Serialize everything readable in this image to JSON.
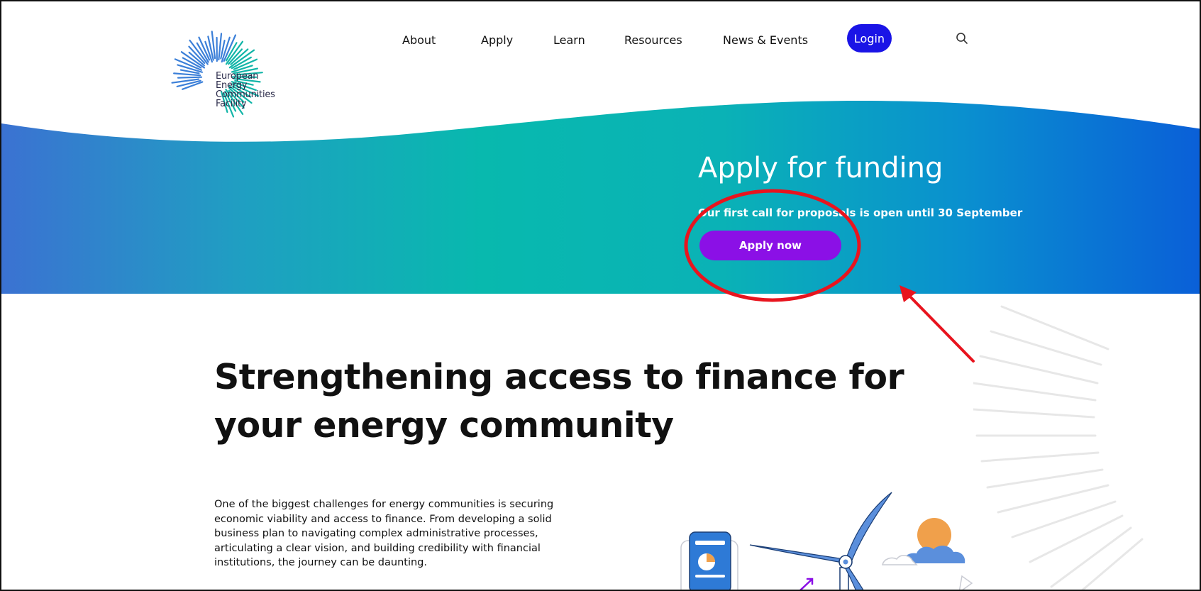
{
  "logo": {
    "icon": "sunburst-logo-icon",
    "lines": [
      "European",
      "Energy",
      "Communities",
      "Facility"
    ]
  },
  "nav": {
    "about": "About",
    "apply": "Apply",
    "learn": "Learn",
    "resources": "Resources",
    "news_events": "News & Events",
    "login": "Login",
    "search_icon": "search-icon"
  },
  "hero": {
    "title": "Apply for funding",
    "subtitle": "Our first call for proposals is open until 30 September",
    "cta": "Apply now"
  },
  "main": {
    "heading": "Strengthening access to finance for your energy community",
    "paragraph": "One of the biggest challenges for energy communities is securing economic viability and access to finance. From developing a solid business plan to navigating complex administrative processes, articulating a clear vision, and building credibility with financial institutions, the journey can be daunting."
  },
  "colors": {
    "login_button": "#1a14e6",
    "apply_now_button": "#8b10e6",
    "hero_gradient_start": "#3a6fd0",
    "hero_gradient_mid": "#0abaa8",
    "hero_gradient_end": "#0a5fd8",
    "annotation_red": "#e8141e"
  }
}
